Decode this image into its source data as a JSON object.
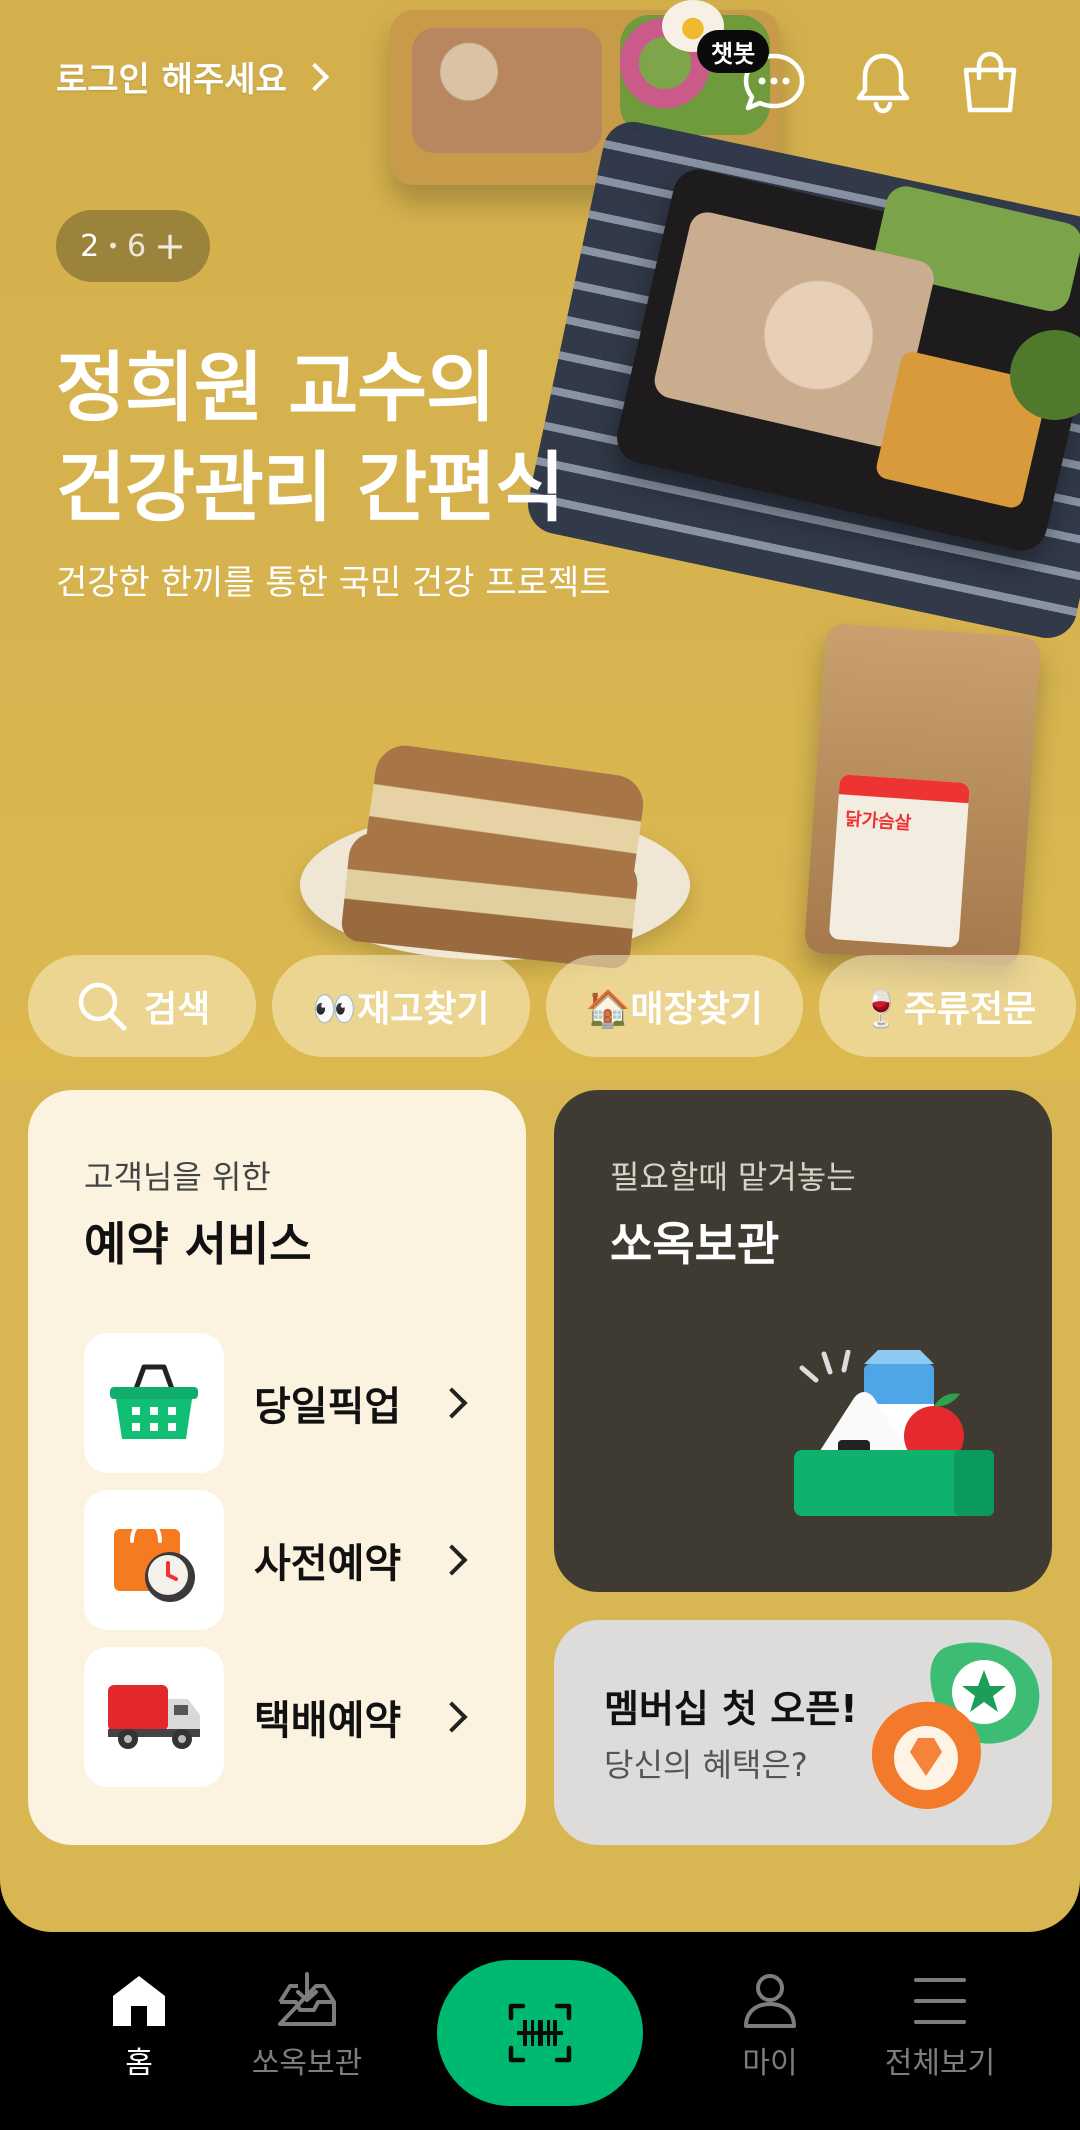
{
  "header": {
    "login_text": "로그인 해주세요",
    "chatbot_badge": "챗봇"
  },
  "banner": {
    "page_current": "2",
    "page_total": "6",
    "title_line1": "정희원 교수의",
    "title_line2": "건강관리 간편식",
    "subtitle": "건강한 한끼를 통한 국민 건강 프로젝트",
    "package_label": "닭가슴살"
  },
  "quick_chips": [
    {
      "label": "검색",
      "icon": "search-icon"
    },
    {
      "label": "👀재고찾기"
    },
    {
      "label": "🏠매장찾기"
    },
    {
      "label": "🍷주류전문"
    }
  ],
  "reserve_card": {
    "kicker": "고객님을 위한",
    "title": "예약 서비스",
    "services": [
      {
        "label": "당일픽업",
        "icon": "basket-icon"
      },
      {
        "label": "사전예약",
        "icon": "shopping-bag-clock-icon"
      },
      {
        "label": "택배예약",
        "icon": "delivery-truck-icon"
      }
    ]
  },
  "storage_card": {
    "kicker": "필요할때 맡겨놓는",
    "title": "쏘옥보관"
  },
  "membership_card": {
    "title": "멤버십 첫 오픈!",
    "subtitle": "당신의 혜택은?"
  },
  "bottom_nav": {
    "items": [
      {
        "label": "홈",
        "icon": "home-icon",
        "active": true
      },
      {
        "label": "쏘옥보관",
        "icon": "inbox-download-icon"
      },
      {
        "label": "",
        "icon": "barcode-scan-icon"
      },
      {
        "label": "마이",
        "icon": "person-icon"
      },
      {
        "label": "전체보기",
        "icon": "menu-icon"
      }
    ]
  },
  "colors": {
    "hero_bg": "#d8b651",
    "accent_green": "#00b971",
    "storage_card_bg": "#3f3b33",
    "reserve_card_bg": "#fbf2df"
  }
}
